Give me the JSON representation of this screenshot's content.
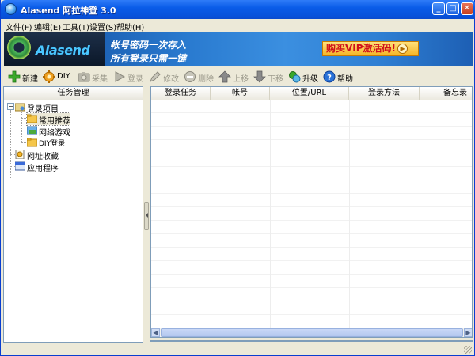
{
  "window": {
    "title": "Alasend 阿拉神登 3.0",
    "controls": {
      "minimize": "_",
      "maximize": "□",
      "close": "✕"
    }
  },
  "menu": {
    "items": [
      "文件(F)",
      "编辑(E)",
      "工具(T)",
      "设置(S)",
      "帮助(H)"
    ]
  },
  "banner": {
    "logo_text": "Alasend",
    "slogan_line1": "帐号密码一次存入",
    "slogan_line2": "所有登录只需一键",
    "vip_label": "购买VIP激活码!"
  },
  "toolbar": {
    "new": "新建",
    "diy": "DIY",
    "collect": "采集",
    "login": "登录",
    "edit": "修改",
    "delete": "删除",
    "move_up": "上移",
    "move_down": "下移",
    "upgrade": "升级",
    "help": "帮助"
  },
  "task_panel": {
    "header": "任务管理",
    "tree": {
      "root": "登录项目",
      "children": [
        "常用推荐",
        "网络游戏",
        "DIY登录"
      ],
      "bookmarks": "网址收藏",
      "apps": "应用程序"
    }
  },
  "grid": {
    "columns": [
      "登录任务",
      "帐号",
      "位置/URL",
      "登录方法",
      "备忘录"
    ]
  },
  "colors": {
    "titlebar": "#0a5ce8",
    "panel_border": "#7f9db9",
    "vip_text": "#d0101a",
    "logo_text": "#4ac7ff"
  }
}
